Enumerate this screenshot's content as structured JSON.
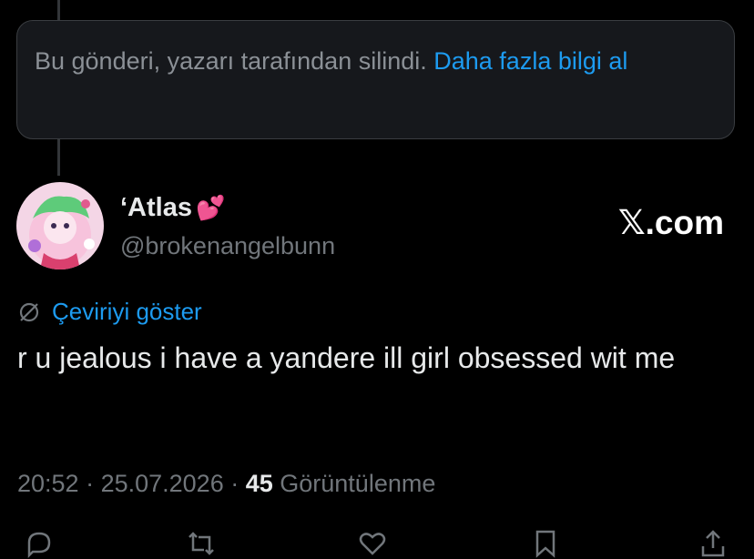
{
  "deleted_notice": {
    "text": "Bu gönderi, yazarı tarafından silindi. ",
    "link": "Daha fazla bilgi al"
  },
  "author": {
    "display_name": "‘Atlas",
    "emoji": "💕",
    "handle": "@brokenangelbunn"
  },
  "brand": "𝕏.com",
  "translate_label": "Çeviriyi göster",
  "tweet_text": "r u jealous i have a yandere ill girl obsessed wit me",
  "meta": {
    "time": "20:52",
    "separator": " · ",
    "date": "25.07.2026",
    "view_count": "45",
    "views_label": " Görüntülenme"
  },
  "actions": [
    "reply-icon",
    "repost-icon",
    "like-icon",
    "bookmark-icon",
    "share-icon"
  ],
  "colors": {
    "background": "#000000",
    "link": "#1d9bf0",
    "secondary_text": "#71767b",
    "primary_text": "#e7e9ea"
  }
}
